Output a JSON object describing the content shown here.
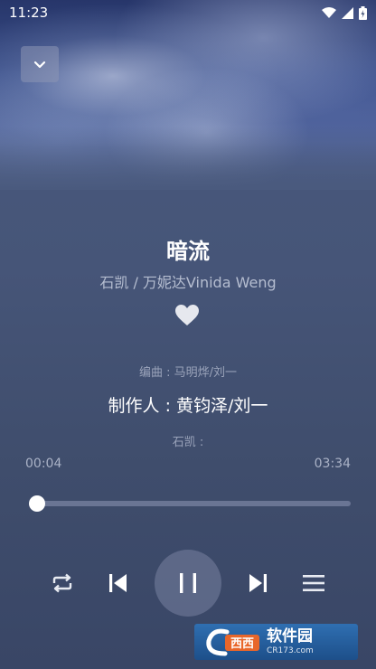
{
  "status_bar": {
    "time": "11:23"
  },
  "song": {
    "title": "暗流",
    "artist": "石凯 / 万妮达Vinida Weng"
  },
  "lyrics": {
    "previous": "编曲 : 马明烨/刘一",
    "current": "制作人 : 黄钧泽/刘一",
    "next": "石凯 :"
  },
  "progress": {
    "elapsed": "00:04",
    "duration": "03:34",
    "fraction": 0.02
  },
  "watermark": {
    "text": "软件园",
    "sub": "CR173.com"
  }
}
